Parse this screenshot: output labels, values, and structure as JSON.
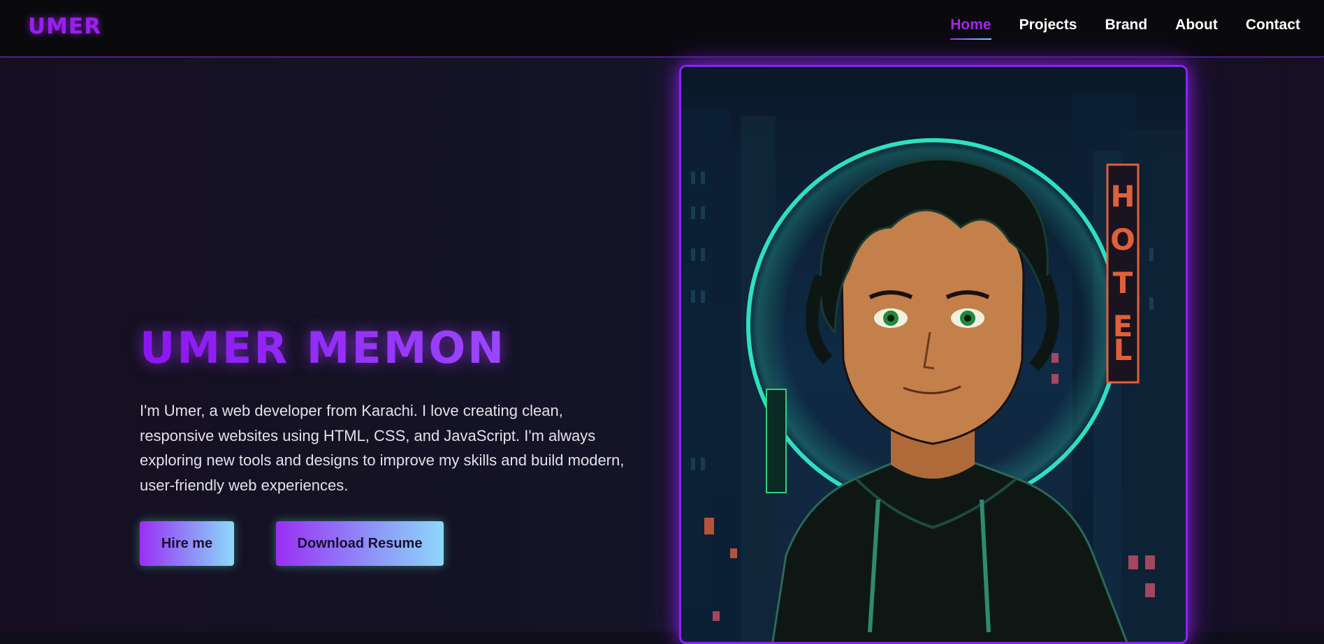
{
  "header": {
    "logo": "UMER",
    "nav": [
      {
        "label": "Home",
        "active": true
      },
      {
        "label": "Projects",
        "active": false
      },
      {
        "label": "Brand",
        "active": false
      },
      {
        "label": "About",
        "active": false
      },
      {
        "label": "Contact",
        "active": false
      }
    ]
  },
  "hero": {
    "name": "UMER MEMON",
    "description": "I'm Umer, a web developer from Karachi. I love creating clean, responsive websites using HTML, CSS, and JavaScript. I'm always exploring new tools and designs to improve my skills and build modern, user-friendly web experiences.",
    "buttons": {
      "hire": "Hire me",
      "resume": "Download Resume"
    },
    "portrait": {
      "sign_text": "HOTEL",
      "sign_color": "#e0603a",
      "halo_color": "#2fe0c0",
      "frame_color": "#8d22f3"
    }
  },
  "colors": {
    "accent": "#9320f2",
    "button_gradient_end": "#8dd8fa",
    "background": "#141426"
  }
}
